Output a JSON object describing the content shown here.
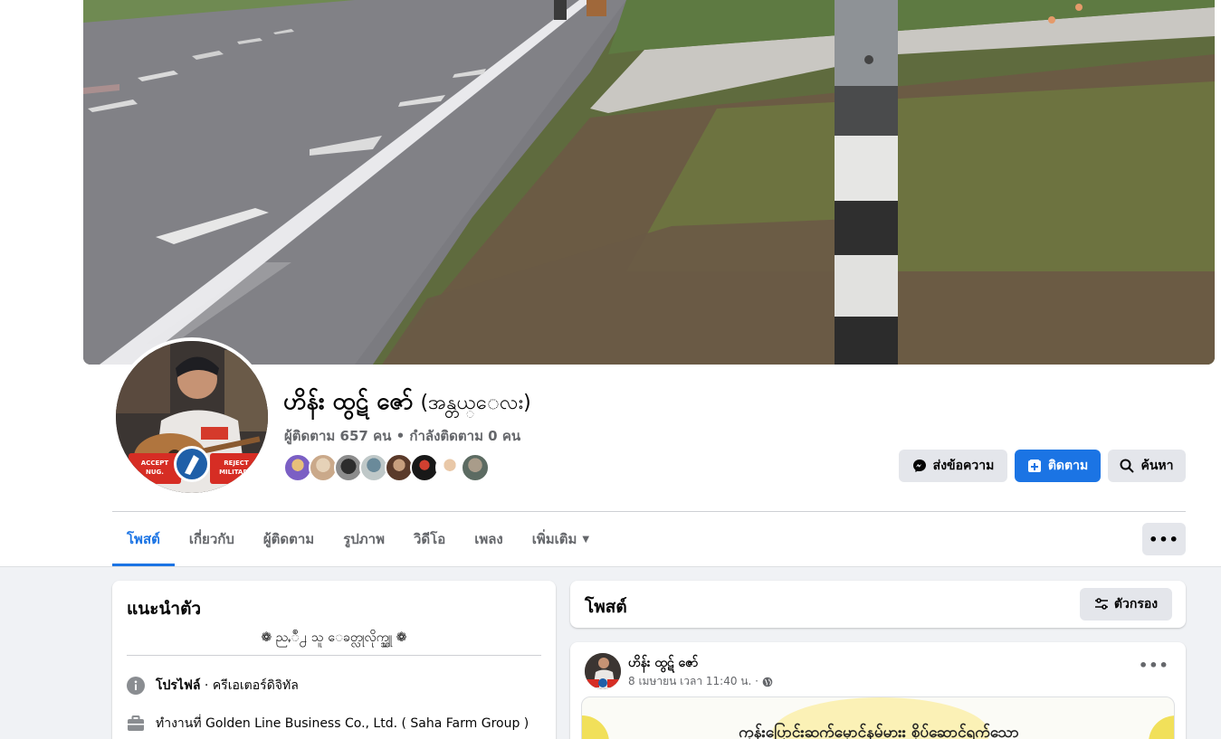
{
  "profile": {
    "name": "ဟိန်း ထွဋ် ဇော်",
    "nickname": "(အန္တယ္ေလး)",
    "follow_stats": "ผู้ติดตาม 657 คน • กำลังติดตาม 0 คน",
    "avatar_sign_left": "ACCEPT NUG.",
    "avatar_sign_right": "REJECT MILITARY."
  },
  "actions": {
    "message_label": "ส่งข้อความ",
    "follow_label": "ติดตาม",
    "search_label": "ค้นหา"
  },
  "tabs": [
    {
      "label": "โพสต์"
    },
    {
      "label": "เกี่ยวกับ"
    },
    {
      "label": "ผู้ติดตาม"
    },
    {
      "label": "รูปภาพ"
    },
    {
      "label": "วิดีโอ"
    },
    {
      "label": "เพลง"
    },
    {
      "label": "เพิ่มเติม"
    }
  ],
  "more_label": "•••",
  "intro": {
    "title": "แนะนำตัว",
    "bio": "❁ ညႇဳ႕ သူ ေခတ္လုလိုက္ပ္သူ ❁",
    "profile_label": "โปรไฟล์",
    "profile_detail": " · ครีเอเตอร์ดิจิทัล",
    "work": "ทำงานที่ Golden Line Business Co., Ltd. ( Saha Farm Group )"
  },
  "posts": {
    "title": "โพสต์",
    "filter_label": "ตัวกรอง"
  },
  "post": {
    "author": "ဟိန်း ထွဋ် ဇော်",
    "meta": "8 เมษายน เวลา 11:40 น. ·",
    "more": "•••",
    "image_text": "ကုန်းပြောင်းဆက်မှောင်နမ်မားး စိုပ်ဆောင်ရက်သော"
  },
  "colors": {
    "accent": "#1b74e4",
    "background": "#f0f2f5",
    "secondary_button": "#e4e6eb",
    "muted_text": "#65676b"
  }
}
